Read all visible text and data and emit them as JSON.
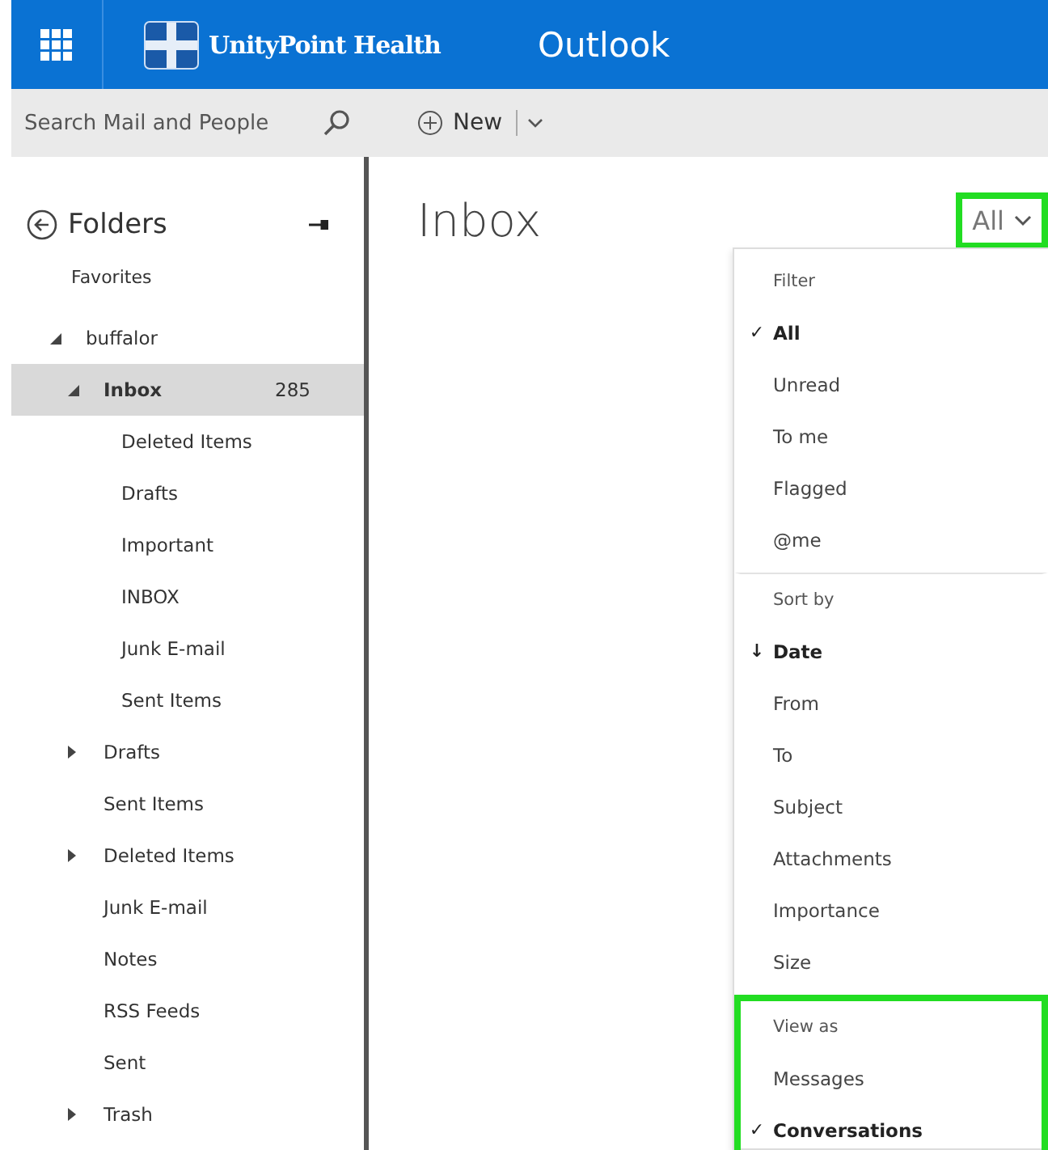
{
  "header": {
    "brand": "UnityPoint Health",
    "app": "Outlook"
  },
  "toolbar": {
    "search": {
      "placeholder": "Search Mail and People"
    },
    "new_button": "New"
  },
  "sidebar": {
    "title": "Folders",
    "favorites": "Favorites",
    "tree": [
      {
        "name": "buffalor",
        "expanded": true,
        "selected": false,
        "children": [
          {
            "name": "Inbox",
            "count": "285",
            "expanded": true,
            "selected": true,
            "children": [
              {
                "name": "Deleted Items",
                "selected": false
              },
              {
                "name": "Drafts",
                "selected": false
              },
              {
                "name": "Important",
                "selected": false
              },
              {
                "name": "INBOX",
                "selected": false
              },
              {
                "name": "Junk E-mail",
                "selected": false
              },
              {
                "name": "Sent Items",
                "selected": false
              }
            ]
          },
          {
            "name": "Drafts",
            "expanded": false,
            "selected": false
          },
          {
            "name": "Sent Items",
            "selected": false
          },
          {
            "name": "Deleted Items",
            "expanded": false,
            "selected": false
          },
          {
            "name": "Junk E-mail",
            "selected": false
          },
          {
            "name": "Notes",
            "selected": false
          },
          {
            "name": "RSS Feeds",
            "selected": false
          },
          {
            "name": "Sent",
            "selected": false
          },
          {
            "name": "Trash",
            "expanded": false,
            "selected": false
          }
        ]
      }
    ]
  },
  "main": {
    "title": "Inbox",
    "filter_button": {
      "label": "All",
      "highlighted": true
    }
  },
  "menu": {
    "sections": [
      {
        "heading": "Filter",
        "marker": "✓",
        "highlighted": false,
        "items": [
          {
            "label": "All",
            "selected": true
          },
          {
            "label": "Unread",
            "selected": false
          },
          {
            "label": "To me",
            "selected": false
          },
          {
            "label": "Flagged",
            "selected": false
          },
          {
            "label": "@me",
            "selected": false
          }
        ]
      },
      {
        "heading": "Sort by",
        "marker": "↓",
        "highlighted": false,
        "items": [
          {
            "label": "Date",
            "selected": true
          },
          {
            "label": "From",
            "selected": false
          },
          {
            "label": "To",
            "selected": false
          },
          {
            "label": "Subject",
            "selected": false
          },
          {
            "label": "Attachments",
            "selected": false
          },
          {
            "label": "Importance",
            "selected": false
          },
          {
            "label": "Size",
            "selected": false
          }
        ]
      },
      {
        "heading": "View as",
        "marker": "✓",
        "highlighted": true,
        "items": [
          {
            "label": "Messages",
            "selected": false
          },
          {
            "label": "Conversations",
            "selected": true
          }
        ]
      }
    ]
  }
}
